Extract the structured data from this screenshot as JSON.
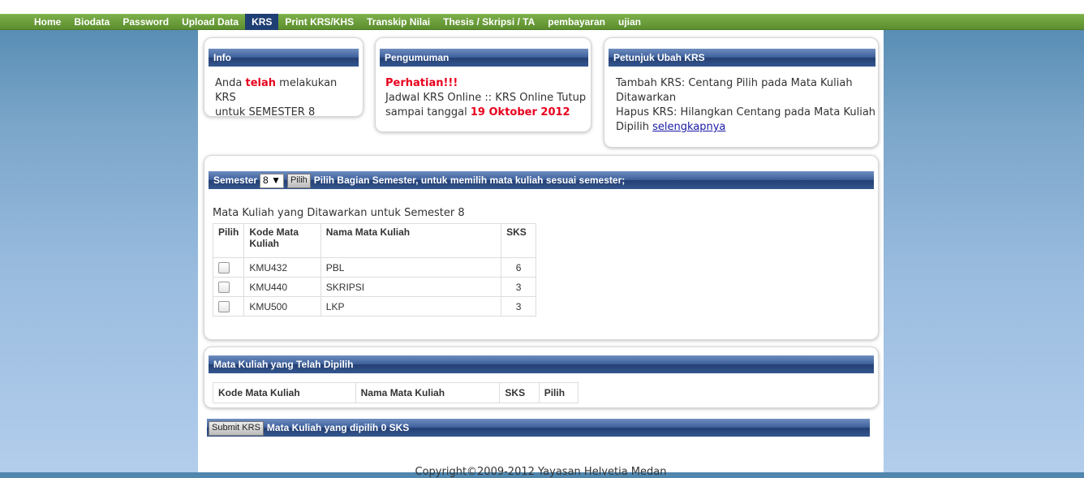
{
  "nav": {
    "items": [
      "Home",
      "Biodata",
      "Password",
      "Upload Data",
      "KRS",
      "Print KRS/KHS",
      "Transkip Nilai",
      "Thesis / Skripsi / TA",
      "pembayaran",
      "ujian"
    ],
    "active": "KRS"
  },
  "info": {
    "title": "Info",
    "text_pre": "Anda",
    "text_bold": "telah",
    "text_post1": "melakukan KRS",
    "text_post2": "untuk SEMESTER 8"
  },
  "pengumuman": {
    "title": "Pengumuman",
    "alert": "Perhatian!!!",
    "line1": "Jadwal KRS Online :: KRS Online Tutup",
    "line2_pre": "sampai tanggal",
    "date": "19 Oktober 2012"
  },
  "petunjuk": {
    "title": "Petunjuk Ubah KRS",
    "line1": "Tambah KRS: Centang Pilih pada Mata Kuliah",
    "line2": "Ditawarkan",
    "line3": "Hapus KRS: Hilangkan Centang pada Mata Kuliah",
    "line4_pre": "Dipilih",
    "link": "selengkapnya"
  },
  "semester_bar": {
    "label": "Semester",
    "selected": "8",
    "button": "Pilih",
    "hint": "Pilih Bagian Semester, untuk memilih mata kuliah sesuai semester;"
  },
  "offered": {
    "caption": "Mata Kuliah yang Ditawarkan untuk Semester 8",
    "headers": [
      "Pilih",
      "Kode Mata Kuliah",
      "Nama Mata Kuliah",
      "SKS"
    ],
    "rows": [
      {
        "kode": "KMU432",
        "nama": "PBL",
        "sks": "6"
      },
      {
        "kode": "KMU440",
        "nama": "SKRIPSI",
        "sks": "3"
      },
      {
        "kode": "KMU500",
        "nama": "LKP",
        "sks": "3"
      }
    ]
  },
  "chosen": {
    "title": "Mata Kuliah yang Telah Dipilih",
    "headers": [
      "Kode Mata Kuliah",
      "Nama Mata Kuliah",
      "SKS",
      "Pilih"
    ]
  },
  "submit": {
    "button": "Submit KRS",
    "text": "Mata Kuliah yang dipilih 0  SKS"
  },
  "footer": "Copyright©2009-2012 Yayasan Helvetia Medan"
}
